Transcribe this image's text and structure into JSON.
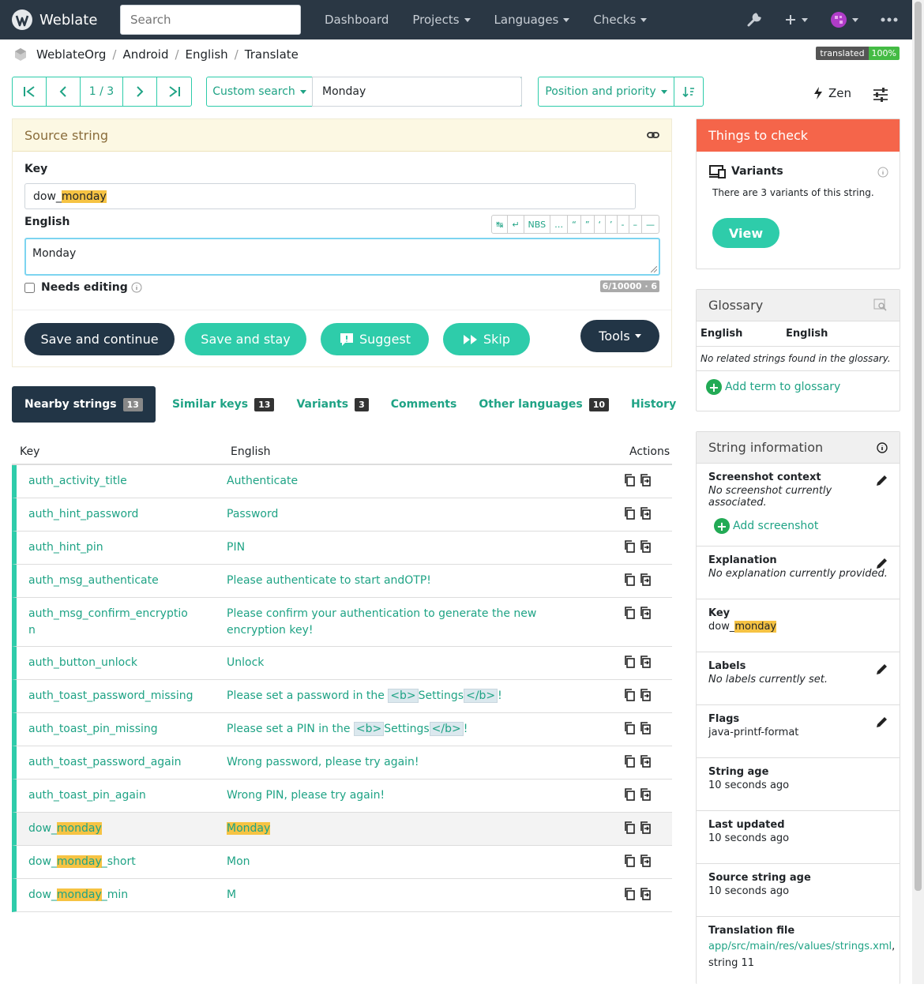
{
  "nav": {
    "brand": "Weblate",
    "search_placeholder": "Search",
    "items": [
      "Dashboard",
      "Projects",
      "Languages",
      "Checks"
    ]
  },
  "breadcrumb": [
    "WeblateOrg",
    "Android",
    "English",
    "Translate"
  ],
  "translated_badge": {
    "label": "translated",
    "value": "100%"
  },
  "pager": {
    "count": "1 / 3"
  },
  "search": {
    "type_label": "Custom search",
    "query": "Monday"
  },
  "sort": {
    "label": "Position and priority"
  },
  "zen": "Zen",
  "source": {
    "title": "Source string",
    "key_label": "Key",
    "key_prefix": "dow_",
    "key_hl": "monday",
    "lang_label": "English",
    "chars": [
      "↹",
      "↵",
      "NBS",
      "…",
      "“",
      "”",
      "‘",
      "’",
      "-",
      "–",
      "—"
    ],
    "text": "Monday",
    "needs_editing": "Needs editing",
    "counter": "6/10000 · 6",
    "buttons": {
      "save_continue": "Save and continue",
      "save_stay": "Save and stay",
      "suggest": "Suggest",
      "skip": "Skip",
      "tools": "Tools"
    }
  },
  "tabs": [
    {
      "label": "Nearby strings",
      "badge": "13"
    },
    {
      "label": "Similar keys",
      "badge": "13"
    },
    {
      "label": "Variants",
      "badge": "3"
    },
    {
      "label": "Comments",
      "badge": ""
    },
    {
      "label": "Other languages",
      "badge": "10"
    },
    {
      "label": "History",
      "badge": ""
    }
  ],
  "table": {
    "headers": [
      "Key",
      "English",
      "Actions"
    ],
    "rows": [
      {
        "key": "auth_activity_title",
        "value": "Authenticate"
      },
      {
        "key": "auth_hint_password",
        "value": "Password"
      },
      {
        "key": "auth_hint_pin",
        "value": "PIN"
      },
      {
        "key": "auth_msg_authenticate",
        "value": "Please authenticate to start andOTP!"
      },
      {
        "key1": "auth_msg_confirm_encryptio",
        "key2": "n",
        "value1": "Please confirm your authentication to generate the new",
        "value2": "encryption key!"
      },
      {
        "key": "auth_button_unlock",
        "value": "Unlock"
      },
      {
        "key": "auth_toast_password_missing",
        "pre": "Please set a password in the ",
        "tag1": "<b>",
        "mid": "Settings",
        "tag2": "</b>",
        "post": "!"
      },
      {
        "key": "auth_toast_pin_missing",
        "pre": "Please set a PIN in the ",
        "tag1": "<b>",
        "mid": "Settings",
        "tag2": "</b>",
        "post": "!"
      },
      {
        "key": "auth_toast_password_again",
        "value": "Wrong password, please try again!"
      },
      {
        "key": "auth_toast_pin_again",
        "value": "Wrong PIN, please try again!"
      },
      {
        "kpre": "dow_",
        "khl": "monday",
        "kpost": "",
        "vhl": "Monday"
      },
      {
        "kpre": "dow_",
        "khl": "monday",
        "kpost": "_short",
        "value": "Mon"
      },
      {
        "kpre": "dow_",
        "khl": "monday",
        "kpost": "_min",
        "value": "M"
      }
    ]
  },
  "checks": {
    "title": "Things to check",
    "variants_title": "Variants",
    "variants_text": "There are 3 variants of this string.",
    "view": "View"
  },
  "glossary": {
    "title": "Glossary",
    "col1": "English",
    "col2": "English",
    "empty": "No related strings found in the glossary.",
    "add": "Add term to glossary"
  },
  "info": {
    "title": "String information",
    "screenshot_t": "Screenshot context",
    "screenshot_d": "No screenshot currently associated.",
    "add_screenshot": "Add screenshot",
    "explanation_t": "Explanation",
    "explanation_d": "No explanation currently provided.",
    "key_t": "Key",
    "key_pre": "dow_",
    "key_hl": "monday",
    "labels_t": "Labels",
    "labels_d": "No labels currently set.",
    "flags_t": "Flags",
    "flags_p": "java-printf-format",
    "age_t": "String age",
    "age_p": "10 seconds ago",
    "updated_t": "Last updated",
    "updated_p": "10 seconds ago",
    "srcage_t": "Source string age",
    "srcage_p": "10 seconds ago",
    "file_t": "Translation file",
    "file_link": "app/src/main/res/values/strings.xml",
    "file_rest": ",",
    "file_string": "string 11"
  },
  "colors": {
    "navbar": "#2a3744",
    "teal": "#2eccaa",
    "dark": "#223546",
    "check_head": "#f5654a",
    "highlight": "#f6c343"
  }
}
